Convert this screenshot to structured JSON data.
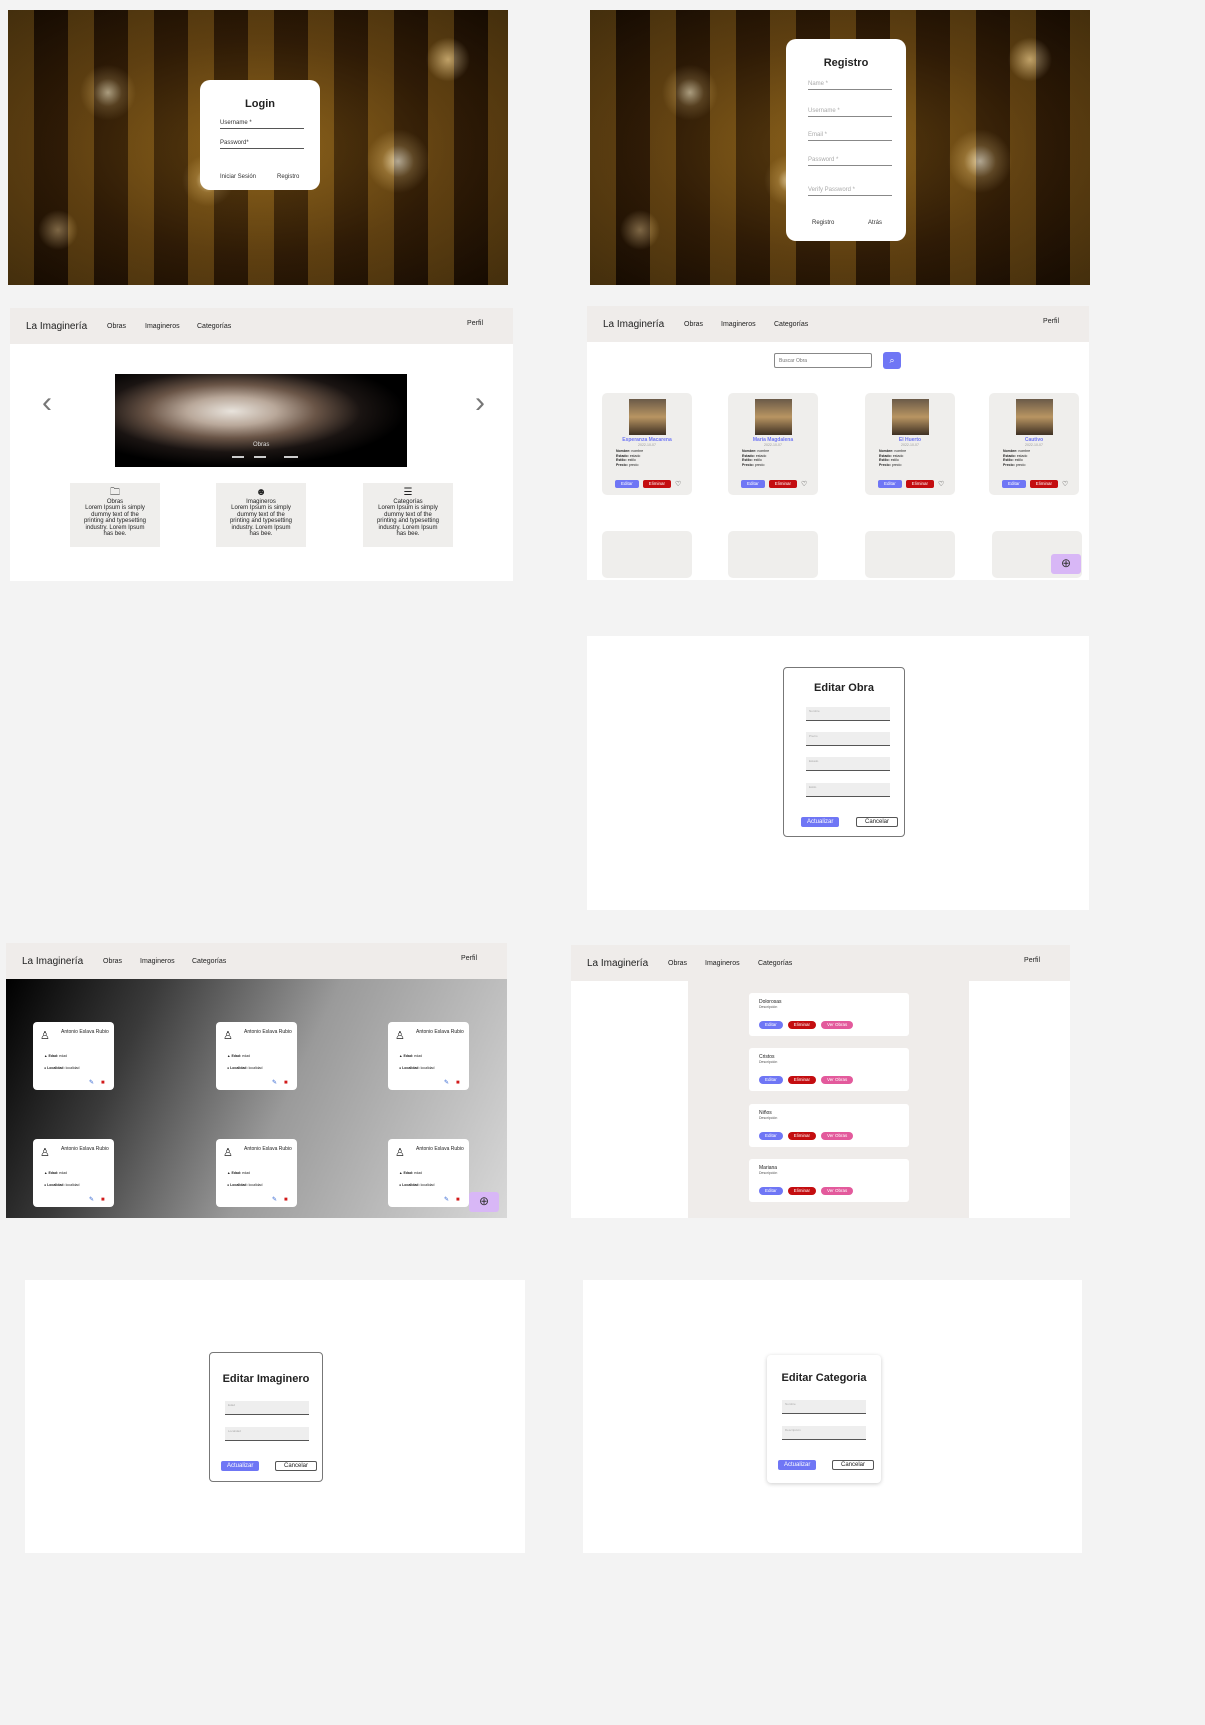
{
  "login": {
    "title": "Login",
    "username": "Username *",
    "password": "Password*",
    "submit": "Iniciar Sesión",
    "register": "Registro"
  },
  "registro": {
    "title": "Registro",
    "fields": [
      "Name *",
      "Username *",
      "Email *",
      "Password *",
      "Verify Password *"
    ],
    "submit": "Registro",
    "back": "Atrás"
  },
  "nav": {
    "brand": "La Imaginería",
    "items": [
      "Obras",
      "Imagineros",
      "Categorías"
    ],
    "profile": "Perfil"
  },
  "home": {
    "carousel_label": "Obras",
    "carousel_prev": "‹",
    "carousel_next": "›",
    "features": [
      {
        "icon": "folder-icon",
        "title": "Obras",
        "text": "Lorem Ipsum is simply dummy text of the printing and typesetting industry. Lorem Ipsum has bee."
      },
      {
        "icon": "face-icon",
        "title": "Imagineros",
        "text": "Lorem Ipsum is simply dummy text of the printing and typesetting industry. Lorem Ipsum has bee."
      },
      {
        "icon": "list-icon",
        "title": "Categorías",
        "text": "Lorem Ipsum is simply dummy text of the printing and typesetting industry. Lorem Ipsum has bee."
      }
    ]
  },
  "obras": {
    "search_placeholder": "Buscar Obra",
    "cards": [
      {
        "name": "Esperanza Macarena",
        "date": "2022-10-07"
      },
      {
        "name": "María Magdalena",
        "date": "2022-10-07"
      },
      {
        "name": "El Huerto",
        "date": "2022-10-07"
      },
      {
        "name": "Cautivo",
        "date": "2022-10-07"
      }
    ],
    "details": [
      {
        "k": "Nombre:",
        "v": "nombre"
      },
      {
        "k": "Estado:",
        "v": "estado"
      },
      {
        "k": "Estilo:",
        "v": "estilo"
      },
      {
        "k": "Precio:",
        "v": "precio"
      }
    ],
    "edit": "Editar",
    "delete": "Eliminar",
    "add": "⊕"
  },
  "editar_obra": {
    "title": "Editar Obra",
    "fields": [
      "Nombre",
      "Precio",
      "Estado",
      "Estilo"
    ],
    "update": "Actualizar",
    "cancel": "Cancelar"
  },
  "imagineros": {
    "name": "Antonio Eslava Rubio",
    "edad_label": "Edad:",
    "edad": "edad",
    "loc_label": "Localidad:",
    "loc": "localidad",
    "add": "⊕"
  },
  "categorias": {
    "items": [
      {
        "name": "Dolorosas",
        "desc": "Descripción"
      },
      {
        "name": "Cristos",
        "desc": "Descripción"
      },
      {
        "name": "Niños",
        "desc": "Descripción"
      },
      {
        "name": "Mariana",
        "desc": "Descripción"
      }
    ],
    "edit": "Editar",
    "delete": "Eliminar",
    "view": "Ver Obras"
  },
  "editar_imaginero": {
    "title": "Editar Imaginero",
    "fields": [
      "Edad",
      "Localidad"
    ],
    "update": "Actualizar",
    "cancel": "Cancelar"
  },
  "editar_categoria": {
    "title": "Editar Categoria",
    "fields": [
      "Nombre",
      "Descripción"
    ],
    "update": "Actualizar",
    "cancel": "Cancelar"
  }
}
